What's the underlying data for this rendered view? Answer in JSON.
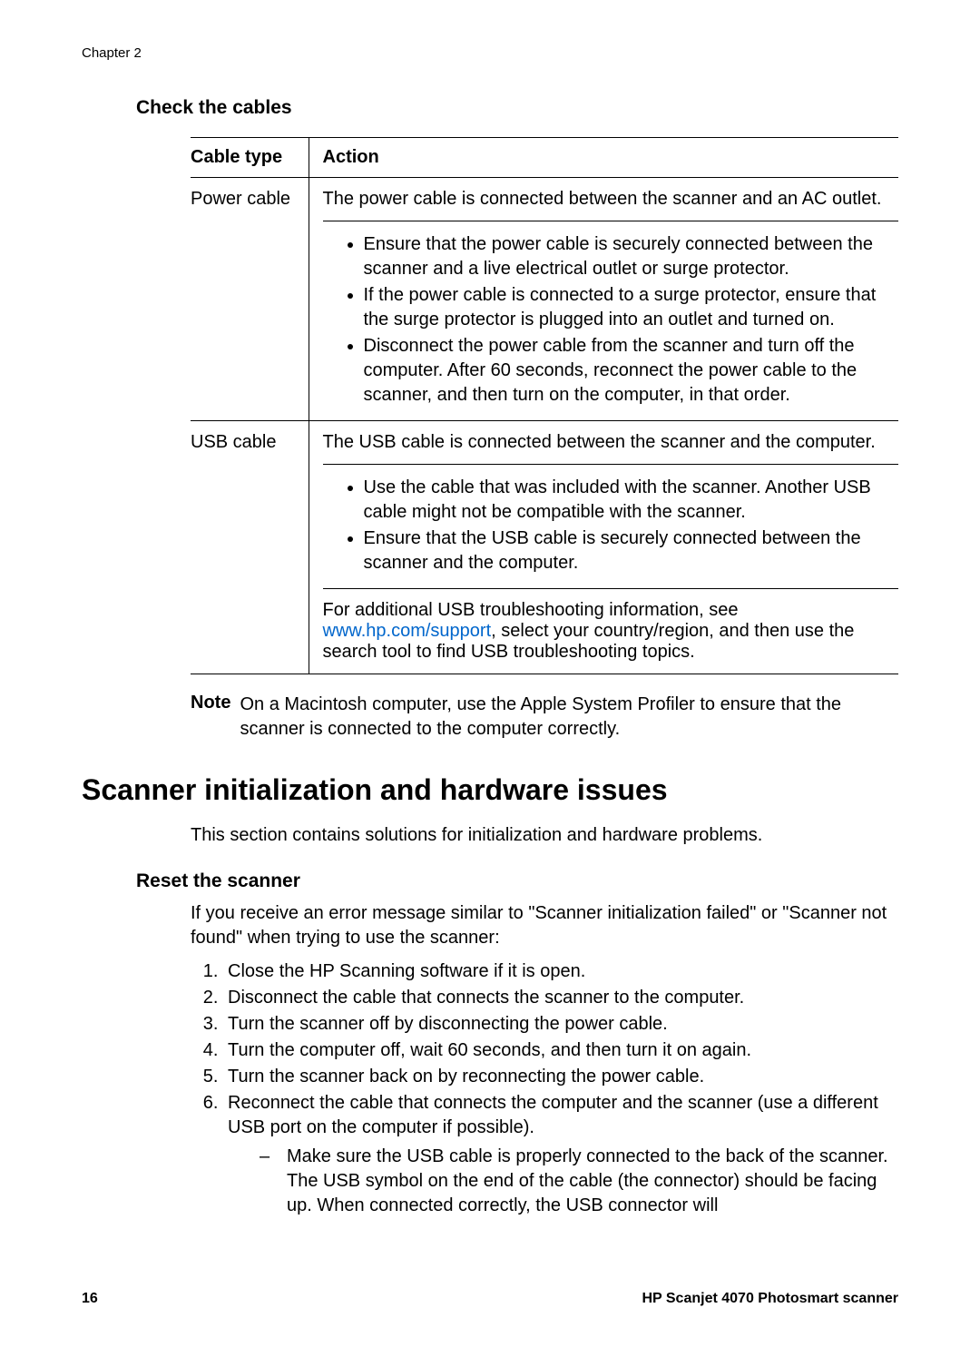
{
  "chapter": "Chapter 2",
  "section1": {
    "title": "Check the cables",
    "table": {
      "header_col1": "Cable type",
      "header_col2": "Action",
      "row1": {
        "type": "Power cable",
        "intro": "The power cable is connected between the scanner and an AC outlet.",
        "bullet1": "Ensure that the power cable is securely connected between the scanner and a live electrical outlet or surge protector.",
        "bullet2": "If the power cable is connected to a surge protector, ensure that the surge protector is plugged into an outlet and turned on.",
        "bullet3": "Disconnect the power cable from the scanner and turn off the computer. After 60 seconds, reconnect the power cable to the scanner, and then turn on the computer, in that order."
      },
      "row2": {
        "type": "USB cable",
        "intro": "The USB cable is connected between the scanner and the computer.",
        "bullet1": "Use the cable that was included with the scanner. Another USB cable might not be compatible with the scanner.",
        "bullet2": "Ensure that the USB cable is securely connected between the scanner and the computer.",
        "footer_pre": "For additional USB troubleshooting information, see ",
        "link1": "www.hp.com/support",
        "footer_post": ", select your country/region, and then use the search tool to find USB troubleshooting topics."
      }
    },
    "note_label": "Note",
    "note_text": "On a Macintosh computer, use the Apple System Profiler to ensure that the scanner is connected to the computer correctly."
  },
  "section2": {
    "title": "Scanner initialization and hardware issues",
    "intro": "This section contains solutions for initialization and hardware problems.",
    "sub_title": "Reset the scanner",
    "para": "If you receive an error message similar to \"Scanner initialization failed\" or \"Scanner not found\" when trying to use the scanner:",
    "step1": "Close the HP Scanning software if it is open.",
    "step2": "Disconnect the cable that connects the scanner to the computer.",
    "step3": "Turn the scanner off by disconnecting the power cable.",
    "step4": "Turn the computer off, wait 60 seconds, and then turn it on again.",
    "step5": "Turn the scanner back on by reconnecting the power cable.",
    "step6": "Reconnect the cable that connects the computer and the scanner (use a different USB port on the computer if possible).",
    "step6_sub1": "Make sure the USB cable is properly connected to the back of the scanner. The USB symbol on the end of the cable (the connector) should be facing up. When connected correctly, the USB connector will"
  },
  "footer": {
    "page": "16",
    "product": "HP Scanjet 4070 Photosmart scanner"
  }
}
